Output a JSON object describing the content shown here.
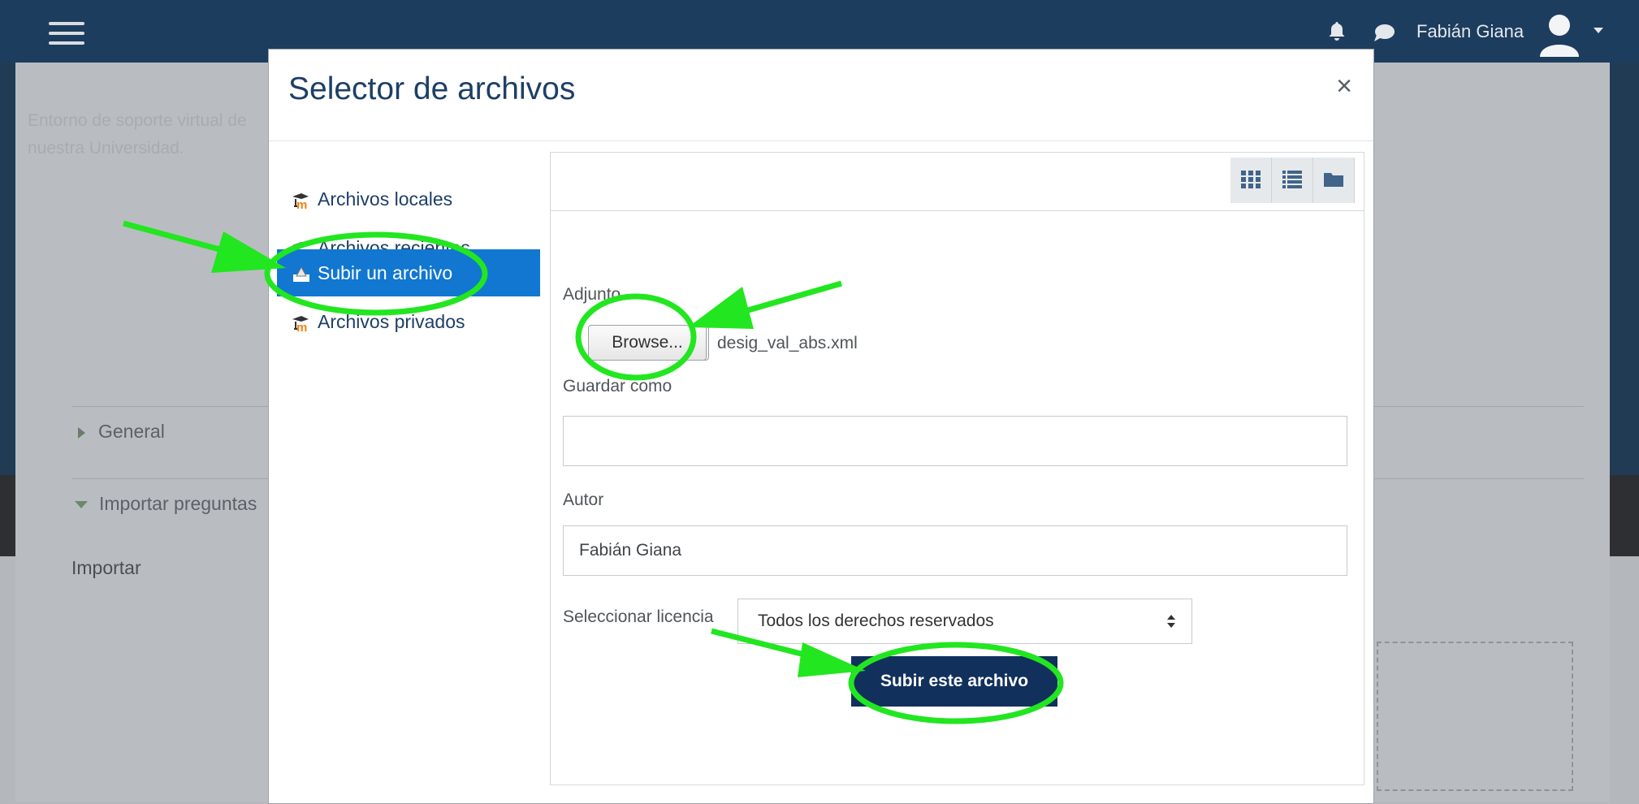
{
  "navbar": {
    "user_name": "Fabián Giana",
    "icons": [
      "menu-icon",
      "bell-icon",
      "chat-icon",
      "user-avatar-icon",
      "caret-down-icon"
    ]
  },
  "page": {
    "intro_text": "Entorno de soporte virtual de nuestra Universidad.",
    "section_general": "General",
    "section_import": "Importar preguntas",
    "import_label": "Importar"
  },
  "modal": {
    "title": "Selector de archivos",
    "close_label": "×",
    "repositories": [
      {
        "label": "Archivos locales",
        "icon": "moodle-icon",
        "active": false
      },
      {
        "label": "Archivos recientes",
        "icon": "moodle-icon",
        "active": false
      },
      {
        "label": "Subir un archivo",
        "icon": "upload-icon",
        "active": true
      },
      {
        "label": "Archivos privados",
        "icon": "moodle-icon",
        "active": false
      }
    ],
    "view_buttons": [
      "grid-view-icon",
      "list-view-icon",
      "folder-view-icon"
    ],
    "form": {
      "attachment_label": "Adjunto",
      "browse_label": "Browse...",
      "file_name": "desig_val_abs.xml",
      "save_as_label": "Guardar como",
      "save_as_value": "",
      "author_label": "Autor",
      "author_value": "Fabián Giana",
      "license_label": "Seleccionar licencia",
      "license_value": "Todos los derechos reservados",
      "submit_label": "Subir este archivo"
    }
  },
  "colors": {
    "navbar": "#1d3d5e",
    "active_item": "#1177d1",
    "submit_button": "#11305c",
    "annotation": "#22e620"
  }
}
